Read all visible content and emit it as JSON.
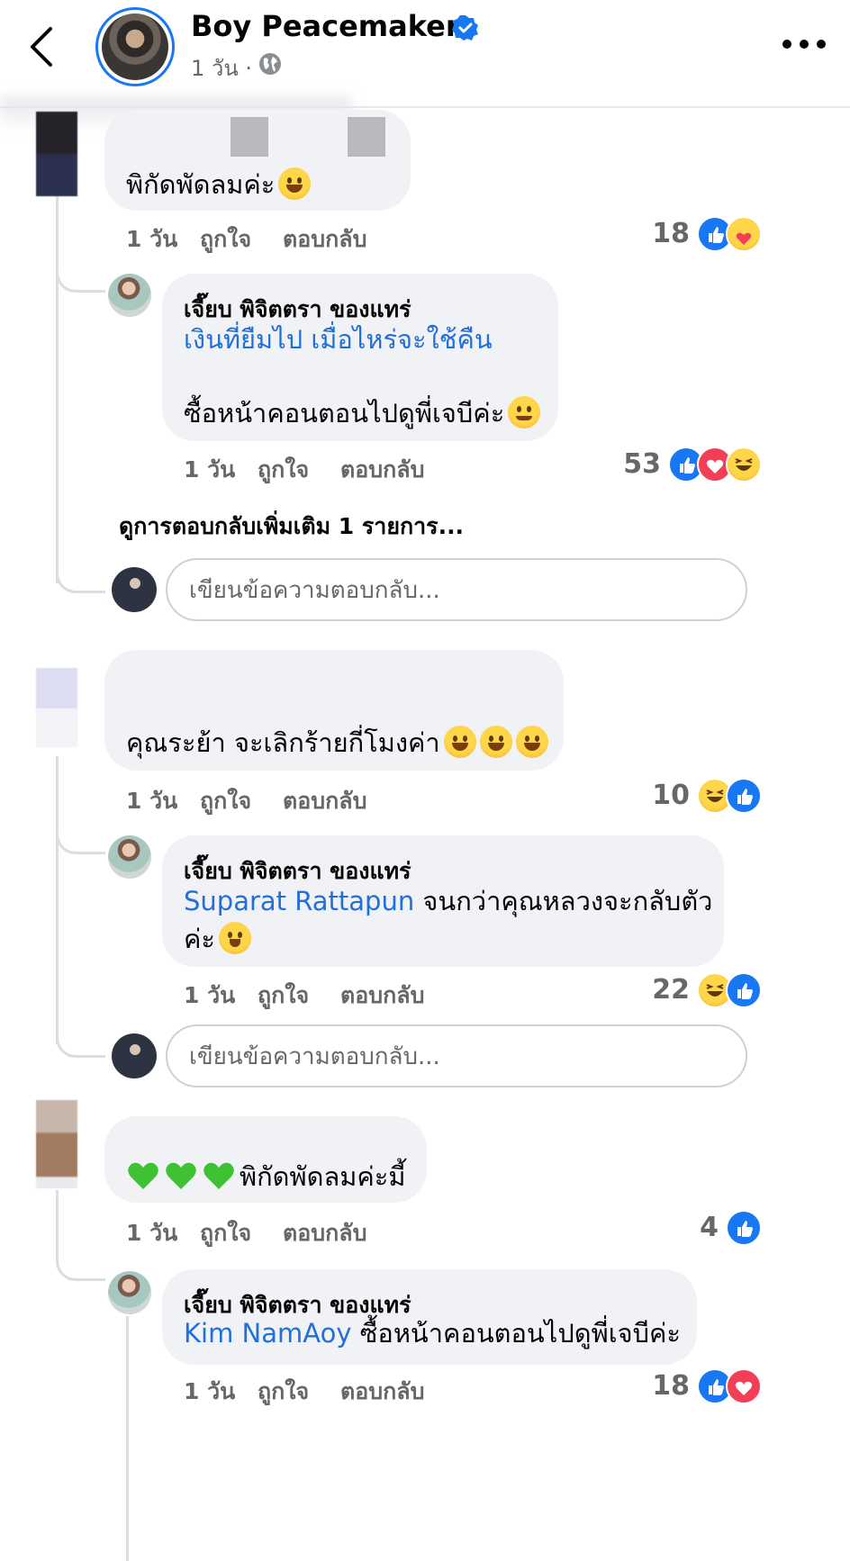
{
  "header": {
    "author_name": "Boy Peacemaker",
    "post_time": "1 วัน ·",
    "accent_color": "#1877f2"
  },
  "icons": {
    "back": "chevron-left-icon",
    "verified": "verified-badge-icon",
    "privacy": "globe-icon",
    "more": "more-dots-icon"
  },
  "actions": {
    "time": "1 วัน",
    "like": "ถูกใจ",
    "reply": "ตอบกลับ"
  },
  "reply_placeholder": "เขียนข้อความตอบกลับ...",
  "more_replies": "ดูการตอบกลับเพิ่มเติม 1 รายการ...",
  "threads": [
    {
      "comment": {
        "text": "พิกัดพัดลมค่ะ",
        "count": "18",
        "reactions": [
          "like",
          "care"
        ]
      },
      "reply": {
        "name": "เจี๊ยบ พิจิตตรา ของแทร่",
        "line1": "เงินที่ยืมไป เมื่อไหร่จะใช้คืน",
        "line2": "ซื้อหน้าคอนตอนไปดูพี่เจบีค่ะ",
        "count": "53",
        "reactions": [
          "like",
          "love",
          "haha"
        ]
      }
    },
    {
      "comment": {
        "text": "คุณระย้า จะเลิกร้ายกี่โมงค่า",
        "count": "10",
        "reactions": [
          "haha",
          "like"
        ]
      },
      "reply": {
        "name": "เจี๊ยบ พิจิตตรา ของแทร่",
        "mention": "Suparat Rattapun",
        "line1": " จนกว่าคุณหลวงจะกลับตัว",
        "line2": "ค่ะ",
        "count": "22",
        "reactions": [
          "haha",
          "like"
        ]
      }
    },
    {
      "comment": {
        "text": "พิกัดพัดลมค่ะมี้",
        "count": "4",
        "reactions": [
          "like"
        ]
      },
      "reply": {
        "name": "เจี๊ยบ พิจิตตรา ของแทร่",
        "mention": "Kim NamAoy",
        "line1": " ซื้อหน้าคอนตอนไปดูพี่เจบีค่ะ",
        "count": "18",
        "reactions": [
          "like",
          "love"
        ]
      }
    }
  ]
}
